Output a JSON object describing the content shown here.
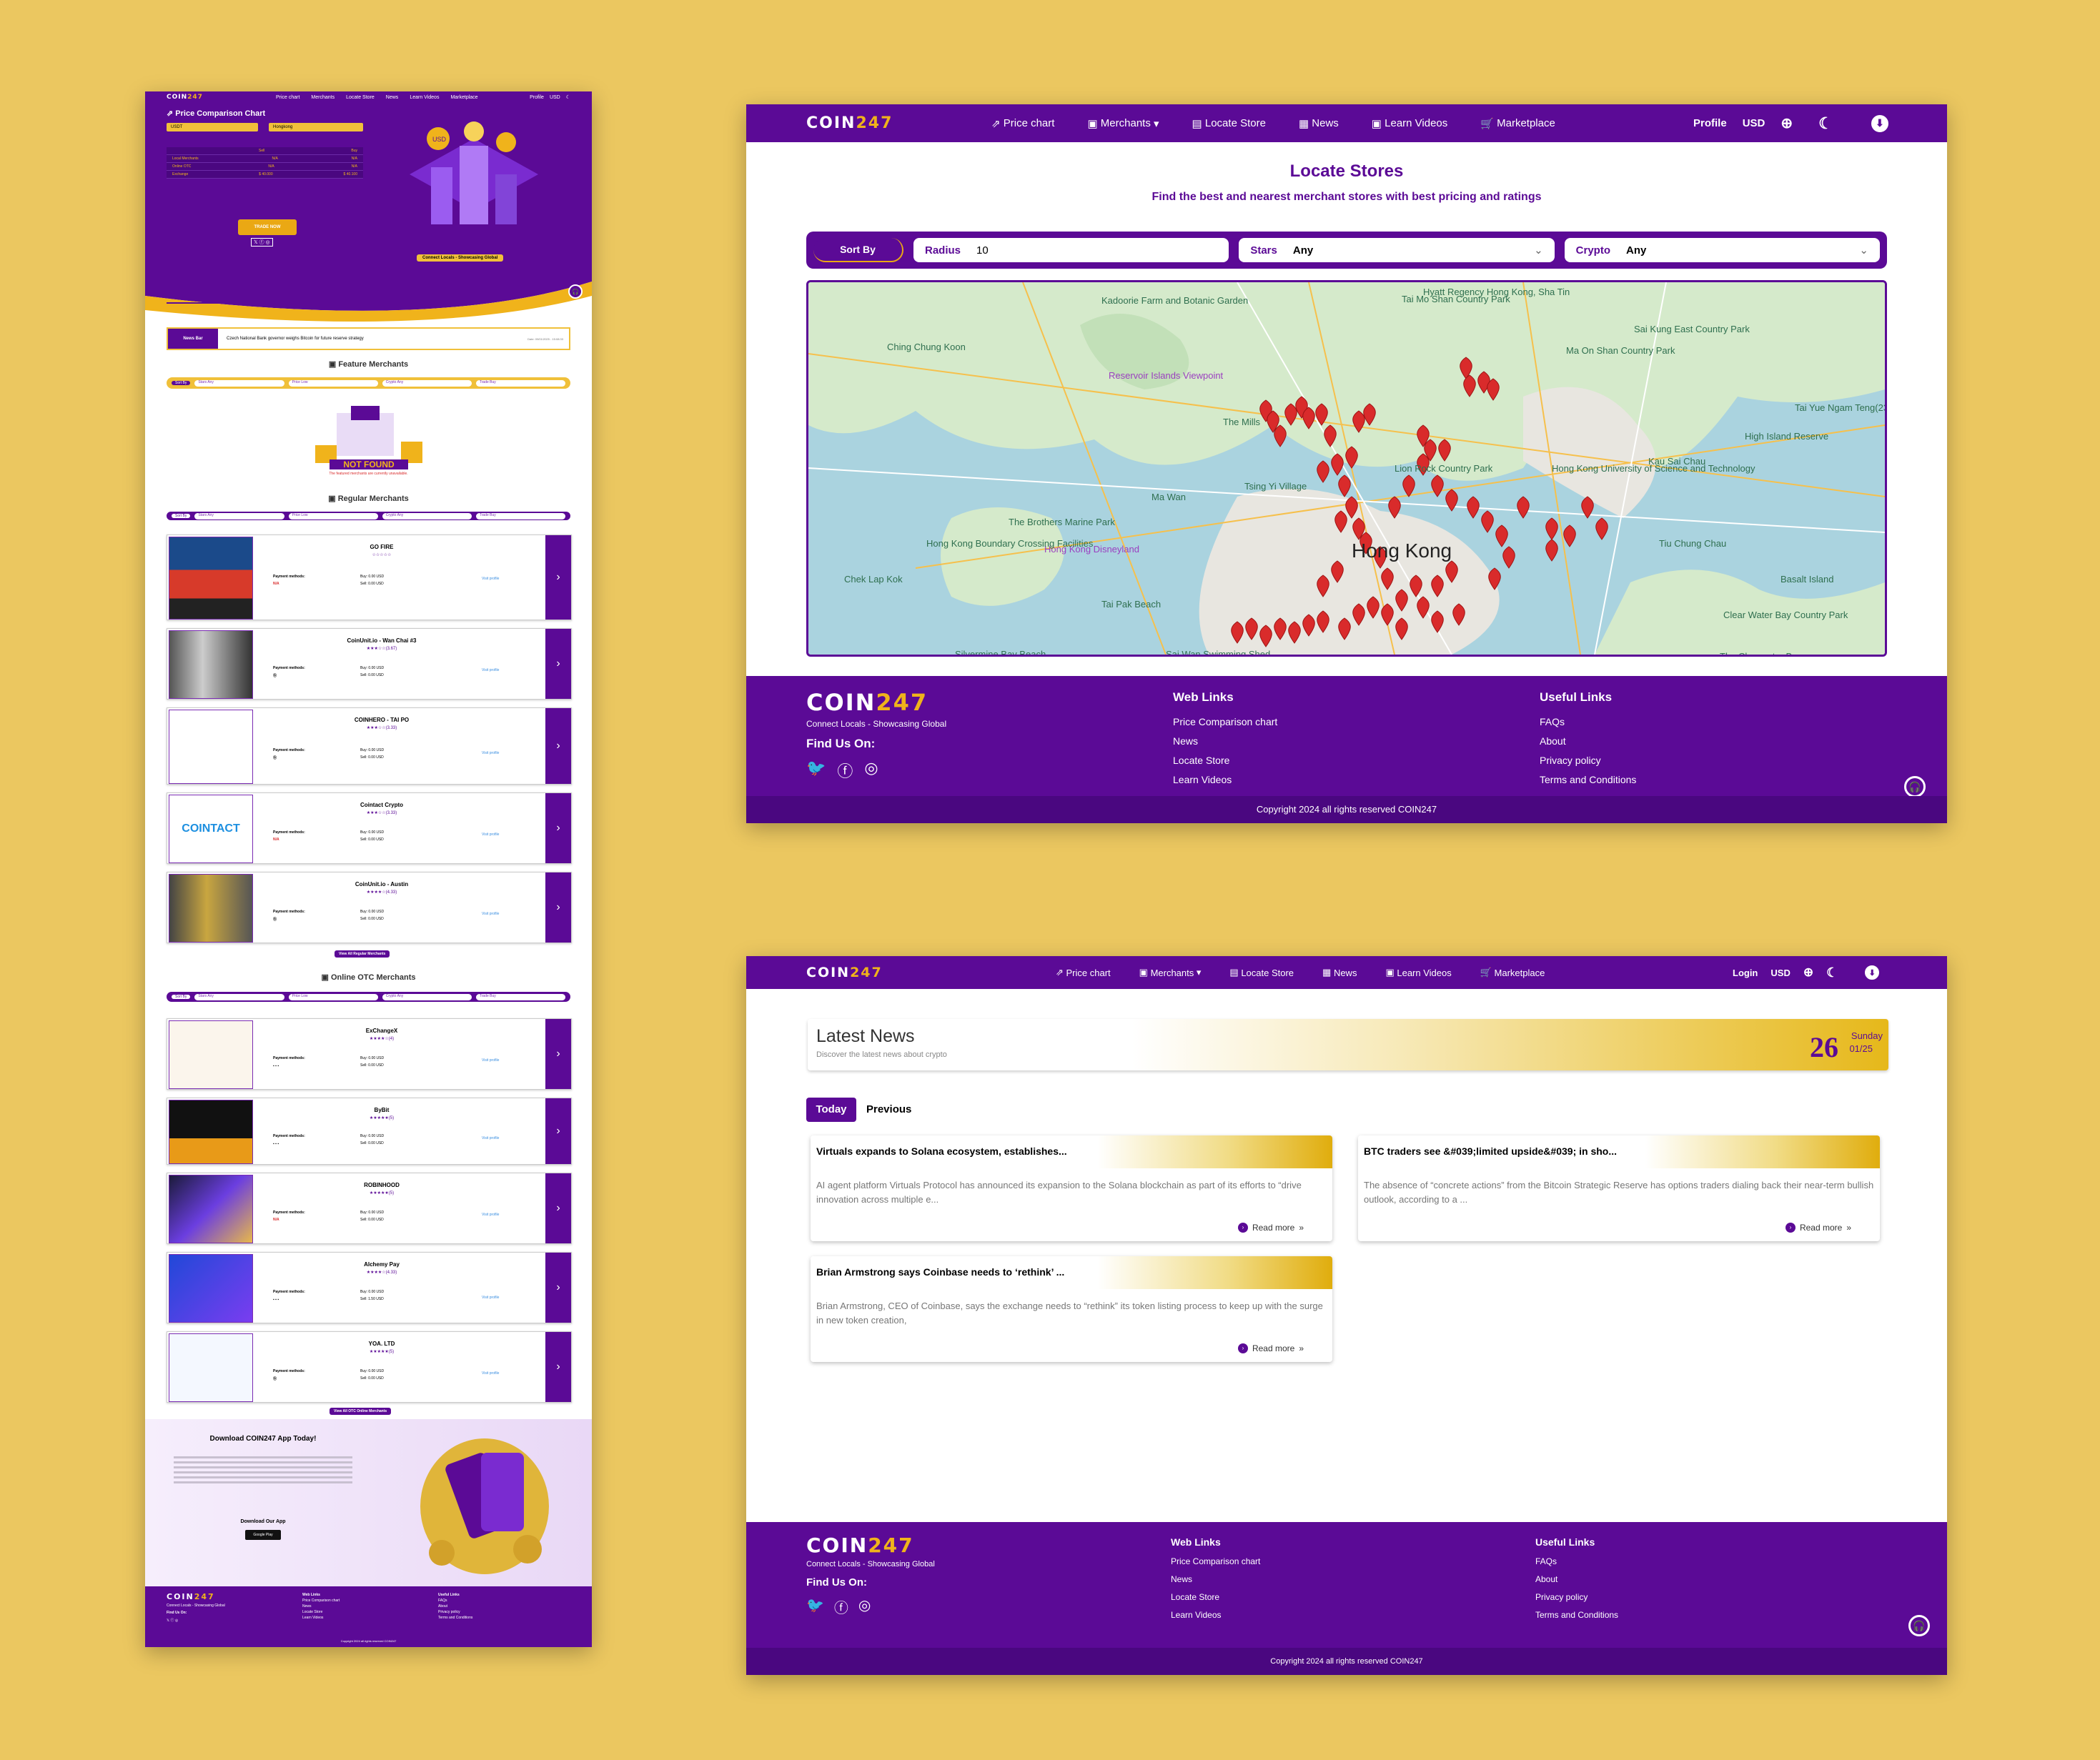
{
  "brand": {
    "logo_left": "COIN",
    "logo_right": "247",
    "tagline": "Connect Locals - Showcasing Global",
    "copyright": "Copyright 2024 all rights reserved COIN247"
  },
  "nav": {
    "price_chart": "Price chart",
    "merchants": "Merchants",
    "locate_store": "Locate Store",
    "news": "News",
    "learn_videos": "Learn Videos",
    "marketplace": "Marketplace",
    "profile": "Profile",
    "login": "Login",
    "currency": "USD"
  },
  "footer": {
    "find_us": "Find Us On:",
    "web_links_title": "Web Links",
    "web_links": [
      "Price Comparison chart",
      "News",
      "Locate Store",
      "Learn Videos"
    ],
    "useful_links_title": "Useful Links",
    "useful_links": [
      "FAQs",
      "About",
      "Privacy policy",
      "Terms and Conditions"
    ]
  },
  "landing": {
    "pcc_title": "Price Comparison Chart",
    "select_crypto": "USDT",
    "select_city": "Hongkong",
    "table_headers": [
      "",
      "Sell",
      "Buy"
    ],
    "table_rows": [
      [
        "Local Merchants",
        "N/A",
        "N/A"
      ],
      [
        "Online OTC",
        "N/A",
        "N/A"
      ],
      [
        "Exchange",
        "$ 40.000",
        "$ 40.100"
      ]
    ],
    "trade_now": "TRADE NOW",
    "connect_badge": "Connect Locals - Showcasing Global",
    "news_bar_label": "News Bar",
    "news_bar_text": "Czech National Bank governor weighs Bitcoin for future reserve strategy",
    "news_bar_date": "Date: 09/01/2025 - 15:08:33",
    "feature_title": "Feature Merchants",
    "not_found": "NOT FOUND",
    "not_found_sub": "The featured merchants are currently unavailable.",
    "regular_title": "Regular Merchants",
    "otc_title": "Online OTC Merchants",
    "filters": {
      "sort": "Sort By",
      "stars": "Stars",
      "stars_val": "Any",
      "price": "Price",
      "price_val": "Low",
      "crypto": "Crypto",
      "crypto_val": "Any",
      "trade": "Trade",
      "trade_val": "Buy"
    },
    "payment_label": "Payment methods:",
    "visit_profile": "Visit profile",
    "regular_merchants": [
      {
        "name": "GO FIRE",
        "stars": "☆☆☆☆☆",
        "payment": "N/A",
        "buy": "Buy: 0.00 USD",
        "sell": "Sell: 0.00 USD"
      },
      {
        "name": "CoinUnit.io - Wan Chai #3",
        "stars": "★★★☆☆(3.67)",
        "payment": "Ⓑ",
        "buy": "Buy: 0.00 USD",
        "sell": "Sell: 0.00 USD"
      },
      {
        "name": "COINHERO - TAI PO",
        "stars": "★★★☆☆(3.33)",
        "payment": "Ⓑ",
        "buy": "Buy: 0.00 USD",
        "sell": "Sell: 0.00 USD"
      },
      {
        "name": "Cointact Crypto",
        "stars": "★★★☆☆(3.33)",
        "payment": "N/A",
        "buy": "Buy: 0.00 USD",
        "sell": "Sell: 0.00 USD"
      },
      {
        "name": "CoinUnit.io - Austin",
        "stars": "★★★★☆(4.33)",
        "payment": "Ⓑ",
        "buy": "Buy: 0.00 USD",
        "sell": "Sell: 0.00 USD"
      }
    ],
    "view_regular": "View All Regular Merchants",
    "otc_merchants": [
      {
        "name": "ExChangeX",
        "stars": "★★★★☆(4)",
        "payment": "▪ ▪ ▪",
        "buy": "Buy: 0.00 USD",
        "sell": "Sell: 0.00 USD"
      },
      {
        "name": "ByBit",
        "stars": "★★★★★(5)",
        "payment": "▪ ▪ ▪",
        "buy": "Buy: 0.00 USD",
        "sell": "Sell: 0.00 USD"
      },
      {
        "name": "ROBINHOOD",
        "stars": "★★★★★(5)",
        "payment": "N/A",
        "buy": "Buy: 0.00 USD",
        "sell": "Sell: 0.00 USD"
      },
      {
        "name": "Alchemy Pay",
        "stars": "★★★★☆(4.33)",
        "payment": "▪ ▪ ▪",
        "buy": "Buy: 0.00 USD",
        "sell": "Sell: 1.50 USD"
      },
      {
        "name": "YOA. LTD",
        "stars": "★★★★★(5)",
        "payment": "Ⓑ",
        "buy": "Buy: 0.00 USD",
        "sell": "Sell: 0.00 USD"
      }
    ],
    "view_otc": "View All OTC Online Merchants",
    "download_title": "Download COIN247 App Today!",
    "download_our_app": "Download Our App",
    "google_play": "Google Play"
  },
  "locate": {
    "title": "Locate Stores",
    "subtitle": "Find the best and nearest merchant stores with best pricing and ratings",
    "sort_by": "Sort By",
    "radius_label": "Radius",
    "radius_value": "10",
    "stars_label": "Stars",
    "stars_value": "Any",
    "crypto_label": "Crypto",
    "crypto_value": "Any",
    "map_labels": [
      "Kadoorie Farm and Botanic Garden",
      "Tai Mo Shan Country Park",
      "Hyatt Regency Hong Kong, Sha Tin",
      "Ching Chung Koon",
      "Reservoir Islands Viewpoint",
      "The Mills",
      "Lion Rock Country Park",
      "Tsing Yi Village",
      "Ma Wan",
      "The Brothers Marine Park",
      "Hong Kong Disneyland",
      "Hong Kong Boundary Crossing Facilities",
      "Chek Lap Kok",
      "Tai Pak Beach",
      "Silvermine Bay Beach",
      "Sai Wan Swimming Shed",
      "Hong Kong University of Science and Technology",
      "Sai Kung East Country Park",
      "Kau Sai Chau",
      "Tiu Chung Chau",
      "Basalt Island",
      "Clear Water Bay Country Park",
      "The Clearwater Bay",
      "Tai Yue Ngam Teng(233m)",
      "High Island Reserve",
      "Ma On Shan Country Park",
      "Hong Kong"
    ]
  },
  "news": {
    "title": "Latest News",
    "subtitle": "Discover the latest news about crypto",
    "day": "26",
    "weekday": "Sunday",
    "month_year": "01/25",
    "tab_today": "Today",
    "tab_previous": "Previous",
    "read_more": "Read more",
    "articles": [
      {
        "title": "Virtuals expands to Solana ecosystem, establishes...",
        "body": "AI agent platform Virtuals Protocol has announced its expansion to the Solana blockchain as part of its efforts to “drive innovation across multiple e..."
      },
      {
        "title": "BTC traders see &#039;limited upside&#039; in sho...",
        "body": "The absence of “concrete actions” from the Bitcoin Strategic Reserve has options traders dialing back their near-term bullish outlook, according to a ..."
      },
      {
        "title": "Brian Armstrong says Coinbase needs to ‘rethink’ ...",
        "body": "Brian Armstrong, CEO of Coinbase, says the exchange needs to “rethink” its token listing process to keep up with the surge in new token creation,"
      }
    ]
  },
  "colors": {
    "purple": "#5b0a96",
    "gold": "#eaa814",
    "background": "#ebc760",
    "pin": "#d92b2b"
  },
  "icons": [
    "chart-icon",
    "shop-icon",
    "map-icon",
    "news-icon",
    "video-icon",
    "cart-icon",
    "globe-icon",
    "moon-icon",
    "download-icon",
    "twitter-icon",
    "facebook-icon",
    "instagram-icon",
    "headset-icon",
    "chevron-right-icon"
  ]
}
